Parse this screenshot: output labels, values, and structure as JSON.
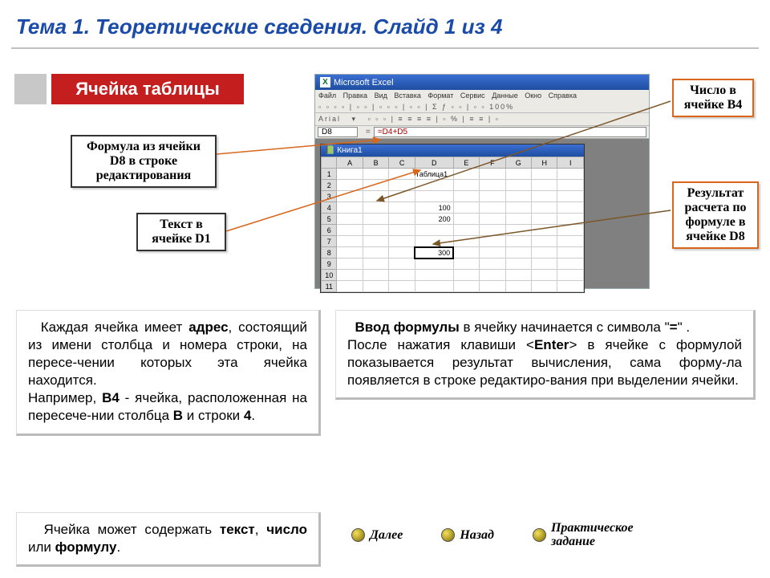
{
  "title": "Тема 1. Теоретические сведения. Слайд 1 из 4",
  "subtitle": "Ячейка таблицы",
  "callouts": {
    "formula_d8": "Формула из ячейки D8 в строке редактирования",
    "text_d1": "Текст в ячейке D1",
    "number_b4": "Число в ячейке B4",
    "result_d8": "Результат расчета по формуле в ячейке D8"
  },
  "excel": {
    "app_title": "Microsoft Excel",
    "menu": [
      "Файл",
      "Правка",
      "Вид",
      "Вставка",
      "Формат",
      "Сервис",
      "Данные",
      "Окно",
      "Справка"
    ],
    "name_box": "D8",
    "formula_text": "=D4+D5",
    "book_title": "Книга1",
    "cols": [
      "A",
      "B",
      "C",
      "D",
      "E",
      "F",
      "G",
      "H",
      "I"
    ],
    "d1": "Таблица1",
    "d4": "100",
    "d5": "200",
    "d8": "300"
  },
  "textbox1": {
    "p1a": "Каждая ячейка имеет ",
    "p1b": "адрес",
    "p1c": ", состоящий из имени столбца и номера строки, на пересе-чении которых эта ячейка находится.",
    "p2a": "Например, ",
    "p2b": "B4",
    "p2c": " - ячейка, расположенная на пересече-нии столбца ",
    "p2d": "B",
    "p2e": " и строки ",
    "p2f": "4",
    "p2g": "."
  },
  "textbox2": {
    "p1a": "Ввод формулы",
    "p1b": " в ячейку начинается с символа   \"",
    "p1c": "=",
    "p1d": "\" .",
    "p2a": "После нажатия клавиши <",
    "p2b": "Enter",
    "p2c": "> в ячейке с формулой показывается результат вычисления, сама форму-ла появляется в строке редактиро-вания при выделении ячейки."
  },
  "textbox3": {
    "a": "Ячейка может содержать ",
    "b": "текст",
    "c": ", ",
    "d": "число",
    "e": " или ",
    "f": "формулу",
    "g": "."
  },
  "nav": {
    "next": "Далее",
    "back": "Назад",
    "practice": "Практическое задание"
  }
}
